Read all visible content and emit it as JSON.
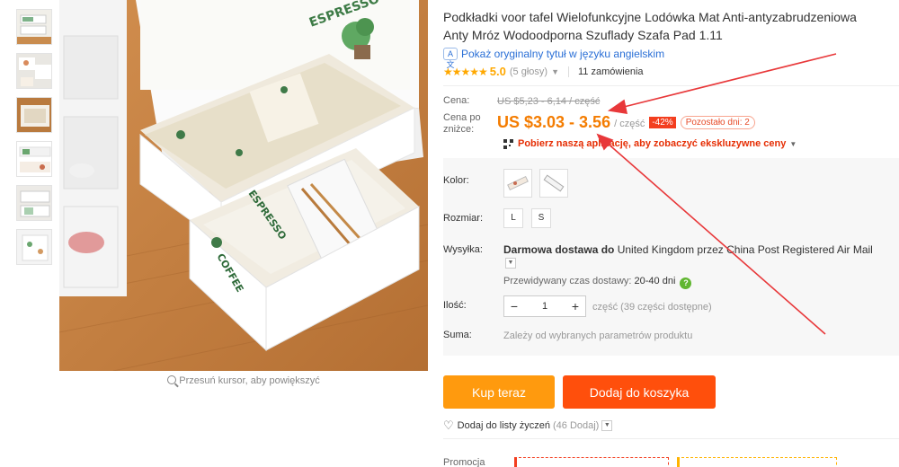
{
  "product": {
    "title": "Podkładki voor tafel Wielofunkcyjne Lodówka Mat Anti-antyzabrudzeniowa Anty Mróz Wodoodporna Szuflady Szafa Pad 1.11",
    "translate_link": "Pokaż oryginalny tytuł w języku angielskim",
    "rating_stars": "★★★★★",
    "rating_value": "5.0",
    "votes": "(5 głosy)",
    "orders": "11 zamówienia"
  },
  "pricing": {
    "price_label": "Cena:",
    "old_price": "US $5,23 - 6,14 / część",
    "deal_label": "Cena po zniżce:",
    "deal_price": "US $3.03 - 3.56",
    "unit": "/ część",
    "discount": "-42%",
    "days_left": "Pozostało dni: 2",
    "app_promo": "Pobierz naszą aplikację, aby zobaczyć ekskluzywne ceny"
  },
  "options": {
    "color_label": "Kolor:",
    "size_label": "Rozmiar:",
    "sizes": [
      "L",
      "S"
    ],
    "shipping_label": "Wysyłka:",
    "shipping_free": "Darmowa dostawa do",
    "shipping_dest": "United Kingdom przez China Post Registered Air Mail",
    "delivery_est_label": "Przewidywany czas dostawy:",
    "delivery_est_value": "20-40 dni",
    "qty_label": "Ilość:",
    "qty_value": "1",
    "qty_minus": "−",
    "qty_plus": "+",
    "qty_note": "część (39 części dostępne)",
    "sum_label": "Suma:",
    "sum_note": "Zależy od wybranych parametrów produktu"
  },
  "actions": {
    "buy_now": "Kup teraz",
    "add_to_cart": "Dodaj do koszyka",
    "wishlist": "Dodaj do listy życzeń",
    "wishlist_count": "(46 Dodaj)"
  },
  "image": {
    "zoom_hint": "Przesuń kursor, aby powiększyć"
  },
  "promo": {
    "label": "Promocja"
  },
  "colors": {
    "deal_orange": "#f47c00",
    "buy_button": "#ff9a0e",
    "cart_button": "#ff4f0c",
    "annotation_arrow": "#e8383a"
  }
}
